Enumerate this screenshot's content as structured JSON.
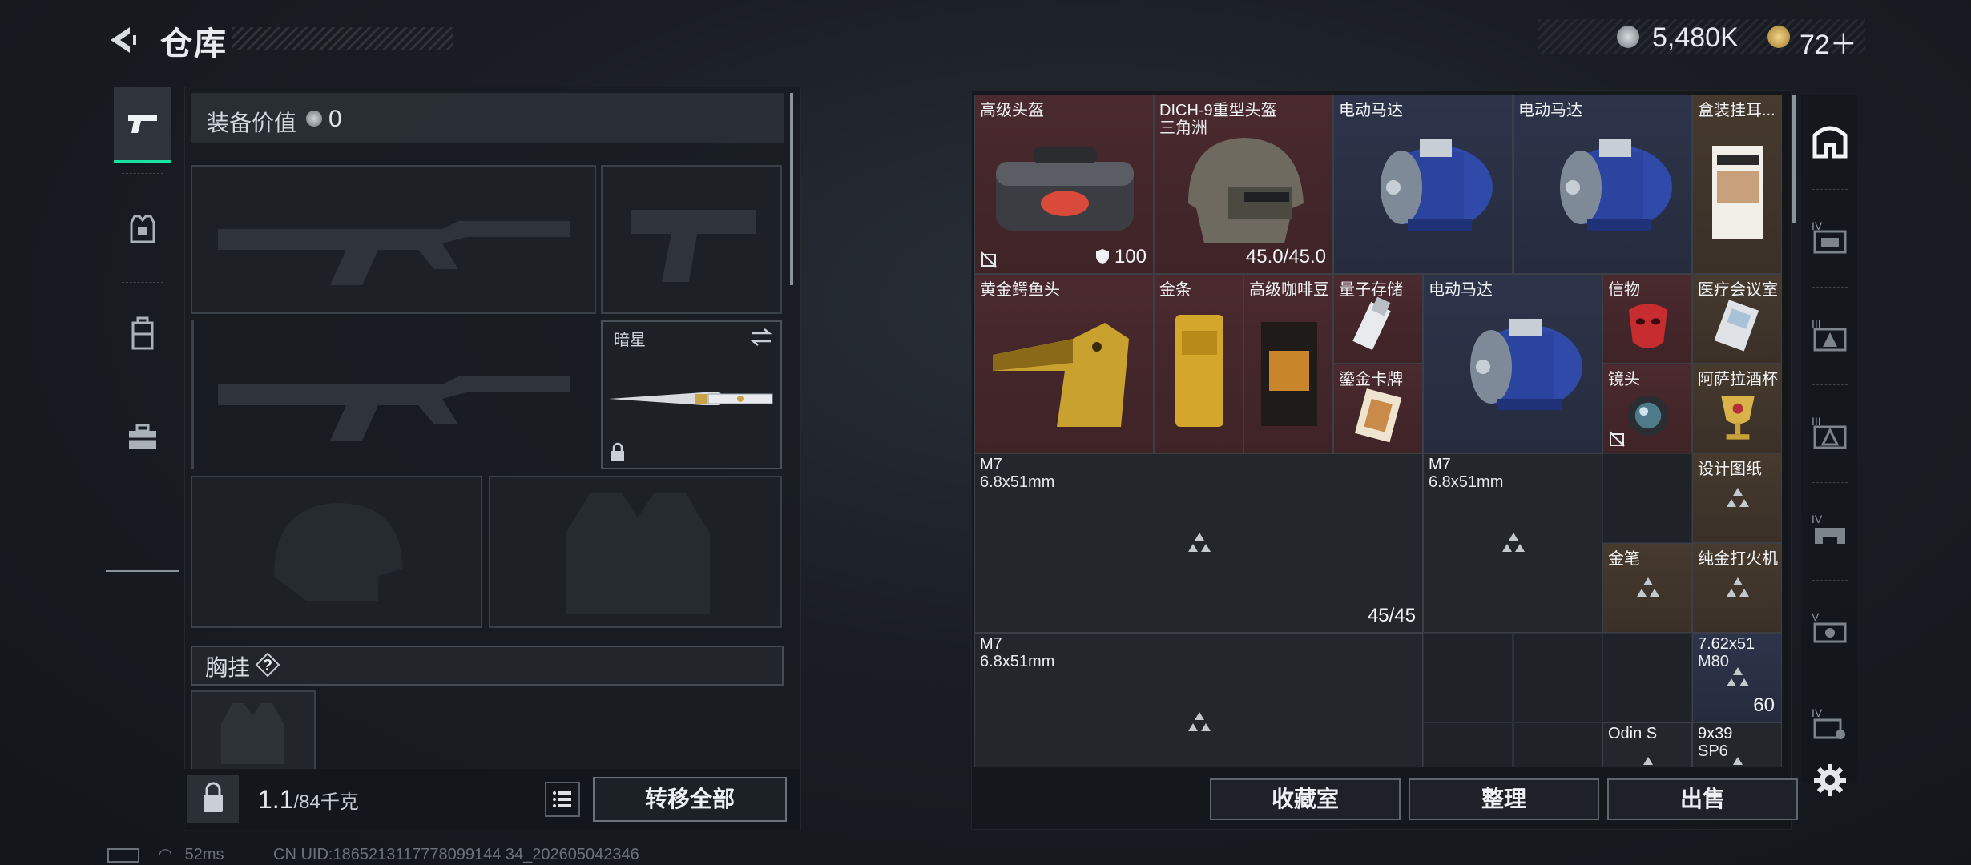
{
  "header": {
    "title": "仓库",
    "currency_primary": "5,480K",
    "currency_secondary": "72＋"
  },
  "equipment": {
    "label": "装备价值",
    "value": "0",
    "melee_slot_label": "暗星",
    "chest_label": "胸挂",
    "chest_help": "?",
    "weight_value": "1.1",
    "weight_capacity": "/84千克",
    "transfer_all": "转移全部"
  },
  "left_tabs": [
    {
      "icon": "pistol-icon",
      "active": true
    },
    {
      "icon": "armor-icon",
      "active": false
    },
    {
      "icon": "backpack-icon",
      "active": false
    },
    {
      "icon": "toolbox-icon",
      "active": false
    }
  ],
  "items": [
    {
      "name": "高级头盔",
      "sub": "",
      "color": "red",
      "stat": "100",
      "stat_icon": "shield-icon",
      "corner_icon": "no-insure-icon",
      "image": "duffel-bag-icon"
    },
    {
      "name": "DICH-9重型头盔",
      "sub": "三角洲",
      "color": "red",
      "stat": "45.0/45.0",
      "image": "heavy-helmet-icon"
    },
    {
      "name": "电动马达",
      "sub": "",
      "color": "blue",
      "image": "electric-motor-icon"
    },
    {
      "name": "电动马达",
      "sub": "",
      "color": "blue",
      "image": "electric-motor-icon"
    },
    {
      "name": "盒装挂耳...",
      "sub": "",
      "color": "gold",
      "image": "coffee-box-icon"
    },
    {
      "name": "黄金鳄鱼头",
      "sub": "",
      "color": "red",
      "image": "gold-croc-head-icon"
    },
    {
      "name": "金条",
      "sub": "",
      "color": "red",
      "image": "gold-bar-icon"
    },
    {
      "name": "高级咖啡豆",
      "sub": "",
      "color": "red",
      "image": "coffee-bag-icon"
    },
    {
      "name": "量子存储",
      "sub": "",
      "color": "red",
      "image": "usb-drive-icon"
    },
    {
      "name": "鎏金卡牌",
      "sub": "",
      "color": "red",
      "image": "gold-card-icon"
    },
    {
      "name": "电动马达",
      "sub": "",
      "color": "blue",
      "image": "electric-motor-icon"
    },
    {
      "name": "信物",
      "sub": "",
      "color": "red",
      "image": "red-mask-icon"
    },
    {
      "name": "医疗会议室",
      "sub": "",
      "color": "gold",
      "image": "keycard-icon"
    },
    {
      "name": "镜头",
      "sub": "",
      "color": "red",
      "corner_icon": "no-insure-icon",
      "image": "camera-lens-icon"
    },
    {
      "name": "阿萨拉酒杯",
      "sub": "",
      "color": "gold",
      "image": "gold-goblet-icon"
    },
    {
      "name": "M7",
      "sub": "6.8x51mm",
      "color": "gray",
      "stat": "45/45",
      "image": "unknown-triangle-icon"
    },
    {
      "name": "M7",
      "sub": "6.8x51mm",
      "color": "gray",
      "image": "unknown-triangle-icon"
    },
    {
      "name": "设计图纸",
      "sub": "",
      "color": "gold",
      "image": "unknown-triangle-icon"
    },
    {
      "name": "金笔",
      "sub": "",
      "color": "gold",
      "image": "unknown-triangle-icon"
    },
    {
      "name": "纯金打火机",
      "sub": "",
      "color": "gold",
      "image": "unknown-triangle-icon"
    },
    {
      "name": "M7",
      "sub": "6.8x51mm",
      "color": "gray",
      "image": "unknown-triangle-icon"
    },
    {
      "name": "7.62x51",
      "sub": "M80",
      "color": "blue",
      "stat": "60",
      "image": "unknown-triangle-icon"
    },
    {
      "name": "Odin S",
      "sub": "",
      "color": "gray",
      "image": "unknown-triangle-icon"
    },
    {
      "name": "9x39",
      "sub": "SP6",
      "color": "gray",
      "image": "unknown-triangle-icon"
    }
  ],
  "actions": {
    "collection": "收藏室",
    "sort": "整理",
    "sell": "出售"
  },
  "right_tabs": [
    {
      "icon": "home-stash-icon",
      "active": true
    },
    {
      "icon": "stash-iv-icon"
    },
    {
      "icon": "stash-iii-icon"
    },
    {
      "icon": "stash-iii-b-icon"
    },
    {
      "icon": "stash-iv-b-icon"
    },
    {
      "icon": "stash-v-icon"
    },
    {
      "icon": "stash-iv-c-icon"
    }
  ],
  "status": {
    "ping": "52ms",
    "uid": "CN UID:1865213117778099144 34_202605042346"
  },
  "colors": {
    "accent": "#19e3a1",
    "red_item": "#4a2a2e",
    "blue_item": "#2d344a",
    "gold_item": "#463a2e"
  }
}
